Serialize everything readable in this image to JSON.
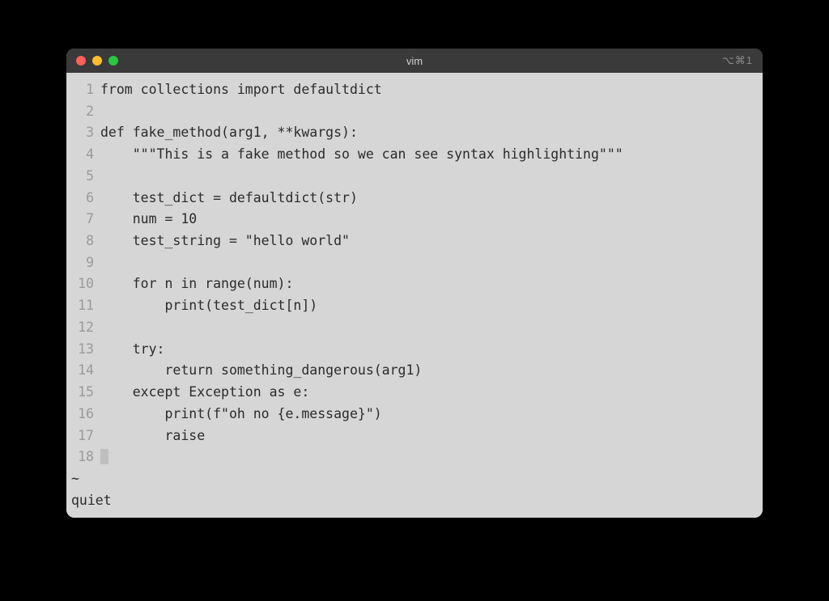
{
  "window": {
    "title": "vim",
    "shortcut": "⌥⌘1"
  },
  "editor": {
    "lines": [
      "from collections import defaultdict",
      "",
      "def fake_method(arg1, **kwargs):",
      "    \"\"\"This is a fake method so we can see syntax highlighting\"\"\"",
      "",
      "    test_dict = defaultdict(str)",
      "    num = 10",
      "    test_string = \"hello world\"",
      "",
      "    for n in range(num):",
      "        print(test_dict[n])",
      "",
      "    try:",
      "        return something_dangerous(arg1)",
      "    except Exception as e:",
      "        print(f\"oh no {e.message}\")",
      "        raise",
      ""
    ],
    "tilde": "~",
    "status": "quiet"
  }
}
